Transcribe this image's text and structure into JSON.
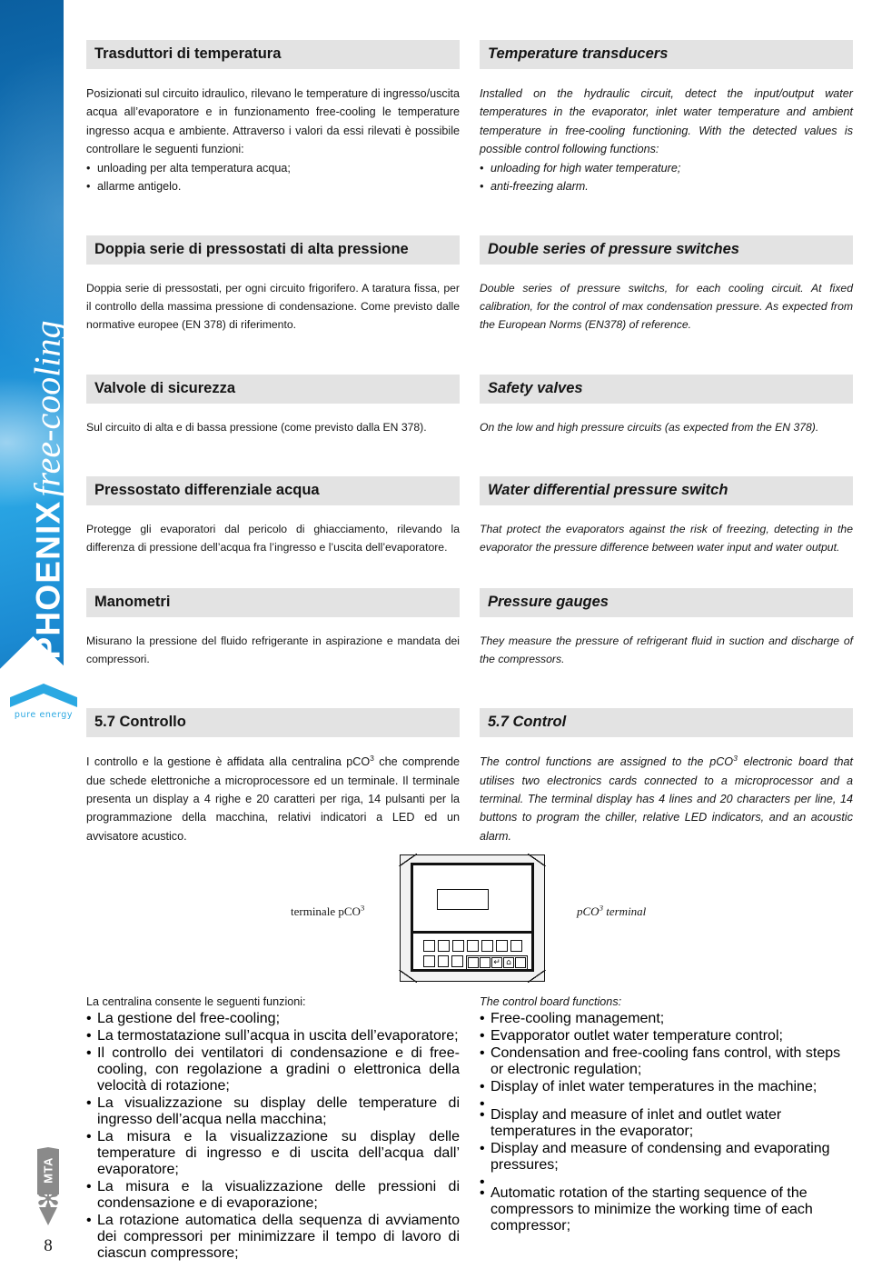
{
  "sidebar": {
    "brand_primary": "PHOENIX",
    "brand_secondary": "free-cooling",
    "logo_tagline": "pure energy",
    "logo_icon": "chevron-icon"
  },
  "footer": {
    "page_number": "8",
    "company_mark": "MTA",
    "company_star": "✻"
  },
  "sections": [
    {
      "it_title": "Trasduttori di temperatura",
      "en_title": "Temperature transducers",
      "it_body": "Posizionati sul circuito idraulico, rilevano le temperature di ingresso/uscita acqua all’evaporatore e in funzionamento free-cooling le temperature ingresso acqua e ambiente. Attraverso i valori da essi rilevati è possibile controllare le seguenti funzioni:",
      "en_body": "Installed on the hydraulic circuit, detect the input/output water temperatures in the evaporator, inlet water temperature and ambient temperature in free-cooling functioning. With the detected values is possible control following functions:",
      "it_bullets": [
        "unloading per alta temperatura acqua;",
        "allarme antigelo."
      ],
      "en_bullets": [
        "unloading for high water temperature;",
        "anti-freezing alarm."
      ]
    },
    {
      "it_title": "Doppia serie di pressostati di alta pressione",
      "en_title": "Double series of pressure switches",
      "it_body": "Doppia serie di pressostati, per ogni circuito frigorifero. A taratura fissa, per il controllo della massima pressione di condensazione. Come previsto dalle normative europee (EN 378) di riferimento.",
      "en_body": "Double series of pressure switchs, for each cooling circuit. At fixed calibration, for the control of max condensation pressure. As expected from the European Norms (EN378) of reference."
    },
    {
      "it_title": "Valvole di sicurezza",
      "en_title": "Safety valves",
      "it_body": "Sul circuito di alta e di bassa pressione (come previsto dalla EN 378).",
      "en_body": "On the low and high pressure circuits (as expected from the EN 378)."
    },
    {
      "it_title": "Pressostato differenziale acqua",
      "en_title": "Water differential pressure switch",
      "it_body": "Protegge gli evaporatori dal pericolo di ghiacciamento, rilevando la differenza di pressione dell’acqua fra l’ingresso e l’uscita dell’evaporatore.",
      "en_body": "That protect the evaporators against the risk of freezing, detecting in the evaporator the pressure difference between water input and water output."
    },
    {
      "it_title": "Manometri",
      "en_title": "Pressure gauges",
      "it_body": "Misurano la pressione del fluido refrigerante in aspirazione e mandata dei compressori.",
      "en_body": "They measure the pressure of refrigerant fluid in suction and discharge of the compressors."
    }
  ],
  "control_section": {
    "it_title": "5.7 Controllo",
    "en_title": "5.7 Control",
    "it_body_1": "I controllo e la gestione è affidata alla centralina pCO",
    "it_sup": "3",
    "it_body_2": " che comprende due schede elettroniche a microprocessore ed un terminale. Il terminale presenta un display a 4 righe e 20 caratteri per riga, 14 pulsanti per la programmazione della macchina, relativi indicatori a LED ed un avvisatore acustico.",
    "en_body_1": "The control functions are assigned to the pCO",
    "en_sup": "3",
    "en_body_2": " electronic board that utilises two electronics cards connected to a microprocessor and a terminal. The terminal display has 4 lines and 20 characters per line, 14 buttons to program the chiller, relative LED indicators, and an acoustic alarm."
  },
  "figure": {
    "label_it_prefix": "terminale pCO",
    "label_it_sup": "3",
    "label_en_prefix": "pCO",
    "label_en_sup": "3",
    "label_en_suffix": " terminal",
    "key_glyphs": [
      "↵",
      "⌂"
    ]
  },
  "functions": {
    "it_intro": "La centralina consente le seguenti funzioni:",
    "en_intro": "The control board functions:",
    "it_items": [
      "La gestione del free-cooling;",
      "La termostatazione sull’acqua in uscita dell’evaporatore;",
      "Il controllo dei ventilatori di condensazione e di free-cooling, con regolazione a gradini o elettronica della velocità di rotazione;",
      "La visualizzazione su display delle temperature di ingresso dell’acqua nella macchina;",
      "La misura e la visualizzazione su display delle temperature di ingresso e di uscita dell’acqua dall’ evaporatore;",
      "La misura e la visualizzazione delle pressioni di condensazione e di evaporazione;",
      "La rotazione automatica della sequenza di avviamento dei compressori per minimizzare il tempo di lavoro di ciascun compressore;"
    ],
    "en_items": [
      "Free-cooling management;",
      "Evapporator outlet water temperature control;",
      "Condensation and free-cooling fans control, with steps or electronic regulation;",
      "Display of inlet water temperatures in the machine;",
      "Display and measure of inlet and outlet water temperatures in the evaporator;",
      "Display and measure of condensing and evaporating pressures;",
      "Automatic rotation of the starting sequence of the compressors to minimize the working time of each compressor;"
    ]
  },
  "colors": {
    "heading_band": "#e3e3e3",
    "brand_blue": "#1b8ad2",
    "accent_cyan": "#2aa8e2"
  }
}
